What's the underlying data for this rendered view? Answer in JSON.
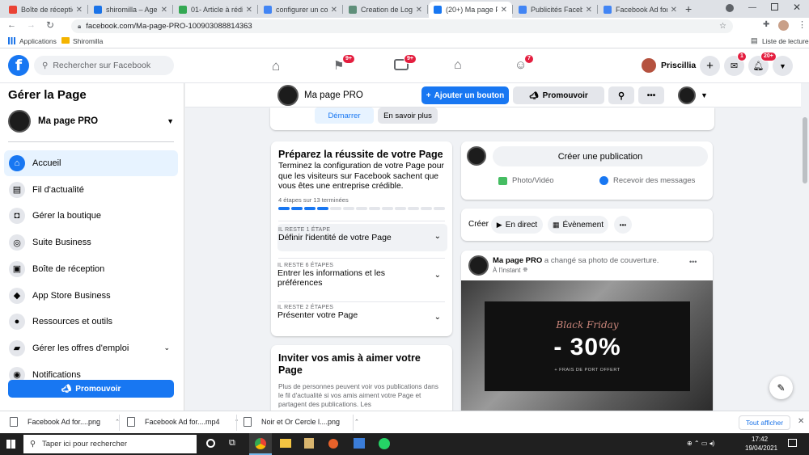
{
  "browser": {
    "tabs": [
      {
        "label": "Boîte de réception",
        "color": "#ea4335",
        "active": false
      },
      {
        "label": "shiromilla – Agenda",
        "color": "#1a73e8",
        "active": false
      },
      {
        "label": "01- Article à rédiger",
        "color": "#34a853",
        "active": false
      },
      {
        "label": "configurer un compte",
        "color": "#4285f4",
        "active": false
      },
      {
        "label": "Creation de Logo",
        "color": "#5f8f7a",
        "active": false
      },
      {
        "label": "(20+) Ma page PRO",
        "color": "#1877f2",
        "active": true
      },
      {
        "label": "Publicités Facebook",
        "color": "#4285f4",
        "active": false
      },
      {
        "label": "Facebook Ad for Hom",
        "color": "#4285f4",
        "active": false
      }
    ],
    "new_tab": "+",
    "url": "facebook.com/Ma-page-PRO-100903088814363",
    "bookmarks": {
      "apps": "Applications",
      "folder": "Shiromilla",
      "reading_list": "Liste de lecture"
    }
  },
  "fb_header": {
    "search_placeholder": "Rechercher sur Facebook",
    "badges": {
      "pages": "9+",
      "watch": "9+",
      "groups": "7",
      "messenger": "1",
      "notifications": "20+"
    },
    "user_name": "Priscillia"
  },
  "sidebar": {
    "title": "Gérer la Page",
    "page_name": "Ma page PRO",
    "items": [
      {
        "label": "Accueil",
        "icon": "home-icon",
        "glyph": "⌂"
      },
      {
        "label": "Fil d'actualité",
        "icon": "news-feed-icon",
        "glyph": "▤"
      },
      {
        "label": "Gérer la boutique",
        "icon": "shop-bag-icon",
        "glyph": "◘"
      },
      {
        "label": "Suite Business",
        "icon": "business-suite-icon",
        "glyph": "◎"
      },
      {
        "label": "Boîte de réception",
        "icon": "inbox-icon",
        "glyph": "▣"
      },
      {
        "label": "App Store Business",
        "icon": "app-store-icon",
        "glyph": "◆"
      },
      {
        "label": "Ressources et outils",
        "icon": "resources-icon",
        "glyph": "●"
      },
      {
        "label": "Gérer les offres d'emploi",
        "icon": "jobs-icon",
        "glyph": "▰"
      },
      {
        "label": "Notifications",
        "icon": "notifications-icon",
        "glyph": "◉"
      }
    ],
    "promote_label": "Promouvoir"
  },
  "page_bar": {
    "name": "Ma page PRO",
    "add_button": "Ajouter un bouton",
    "promote": "Promouvoir"
  },
  "cta_buttons": {
    "start": "Démarrer",
    "learn_more": "En savoir plus"
  },
  "setup_card": {
    "title": "Préparez la réussite de votre Page",
    "description": "Terminez la configuration de votre Page pour que les visiteurs sur Facebook sachent que vous êtes une entreprise crédible.",
    "progress_text": "4 étapes sur 13 terminées",
    "progress_done": 4,
    "progress_total": 13,
    "steps": [
      {
        "remaining": "IL RESTE 1 ÉTAPE",
        "label": "Définir l'identité de votre Page"
      },
      {
        "remaining": "IL RESTE 6 ÉTAPES",
        "label": "Entrer les informations et les préférences"
      },
      {
        "remaining": "IL RESTE 2 ÉTAPES",
        "label": "Présenter votre Page"
      }
    ]
  },
  "invite_card": {
    "title": "Inviter vos amis à aimer votre Page",
    "text": "Plus de personnes peuvent voir vos publications dans le fil d'actualité si vos amis aiment votre Page et partagent des publications. Les"
  },
  "composer": {
    "create_post": "Créer une publication",
    "photo_video": "Photo/Vidéo",
    "messages": "Recevoir des messages"
  },
  "create_bar": {
    "label": "Créer",
    "live": "En direct",
    "event": "Évènement"
  },
  "post": {
    "author": "Ma page PRO",
    "action": "a changé sa photo de couverture.",
    "time": "À l'instant",
    "image_script": "Black Friday",
    "image_big": "- 30%",
    "image_small": "+ FRAIS DE PORT OFFERT"
  },
  "downloads": {
    "items": [
      "Facebook Ad for....png",
      "Facebook Ad for....mp4",
      "Noir et Or Cercle l....png"
    ],
    "show_all": "Tout afficher"
  },
  "taskbar": {
    "search_placeholder": "Taper ici pour rechercher",
    "time": "17:42",
    "date": "19/04/2021"
  }
}
